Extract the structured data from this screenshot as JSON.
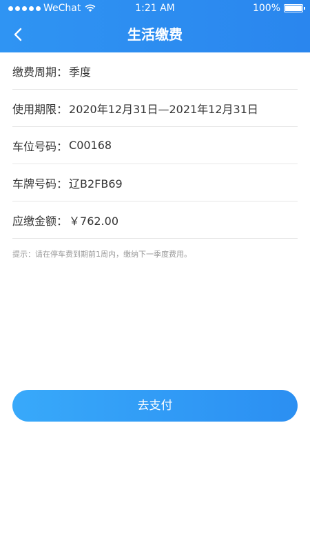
{
  "status_bar": {
    "carrier": "WeChat",
    "time": "1:21 AM",
    "battery": "100%"
  },
  "nav": {
    "title": "生活缴费",
    "back_icon": "chevron-left-icon"
  },
  "details": [
    {
      "label": "缴费周期：",
      "value": "季度"
    },
    {
      "label": "使用期限：",
      "value": "2020年12月31日—2021年12月31日"
    },
    {
      "label": "车位号码：",
      "value": "C00168"
    },
    {
      "label": "车牌号码：",
      "value": "辽B2FB69"
    },
    {
      "label": "应缴金额：",
      "value": "￥762.00"
    }
  ],
  "tip": "提示：请在停车费到期前1周内，缴纳下一季度费用。",
  "pay_button": {
    "label": "去支付"
  },
  "colors": {
    "header": "#2f94f3",
    "button": "#2b8ff2"
  }
}
